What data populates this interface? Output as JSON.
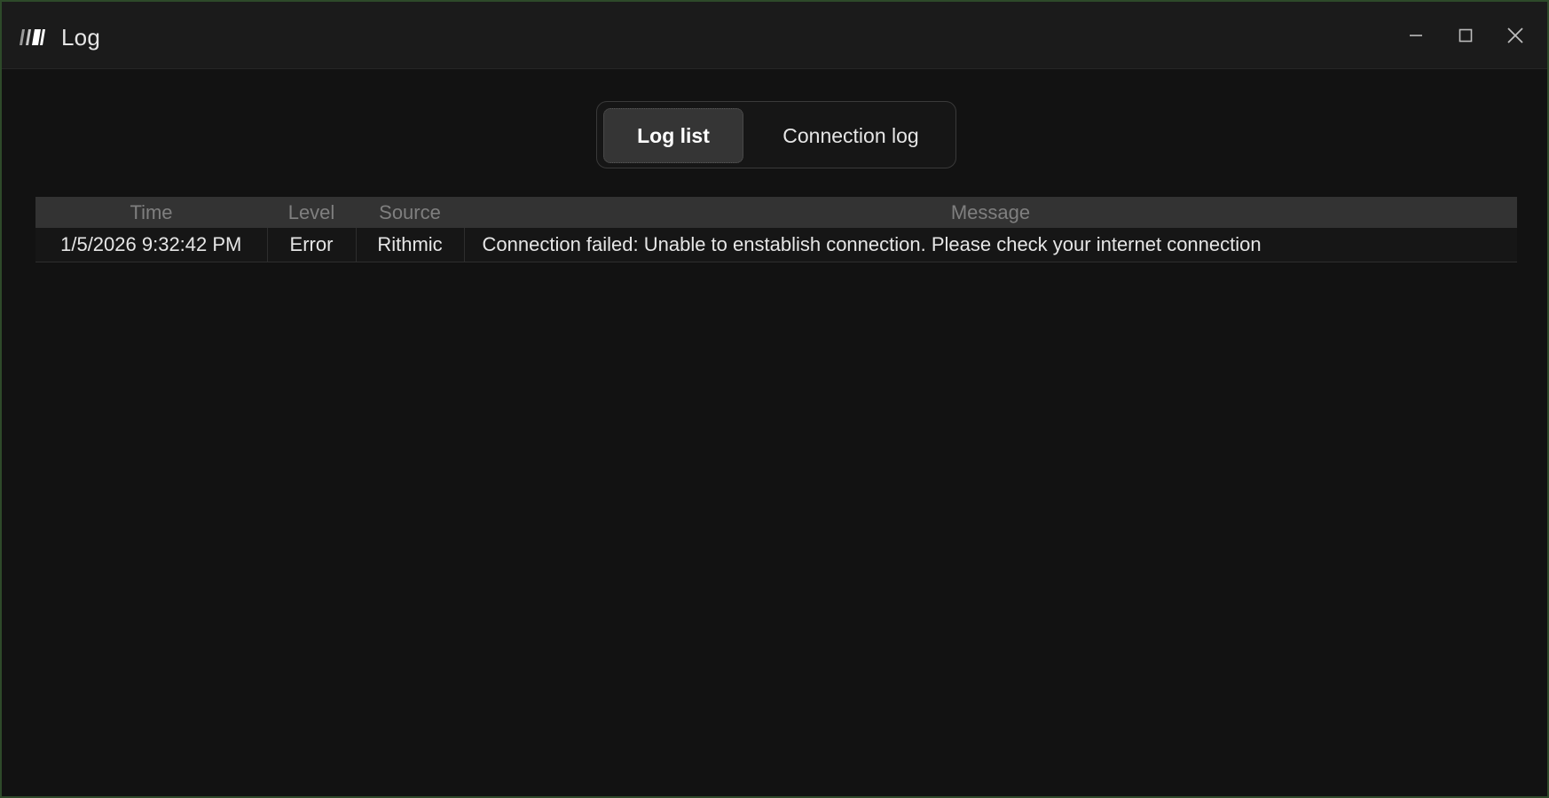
{
  "window": {
    "title": "Log",
    "border_color": "#2e4a2a"
  },
  "controls": {
    "minimize": "minimize-icon",
    "maximize": "maximize-icon",
    "close": "close-icon"
  },
  "tabs": [
    {
      "label": "Log list",
      "active": true
    },
    {
      "label": "Connection log",
      "active": false
    }
  ],
  "table": {
    "columns": [
      "Time",
      "Level",
      "Source",
      "Message"
    ],
    "rows": [
      {
        "time": "1/5/2026 9:32:42 PM",
        "level": "Error",
        "source": "Rithmic",
        "message": "Connection failed: Unable to enstablish connection. Please check your internet connection"
      }
    ]
  }
}
